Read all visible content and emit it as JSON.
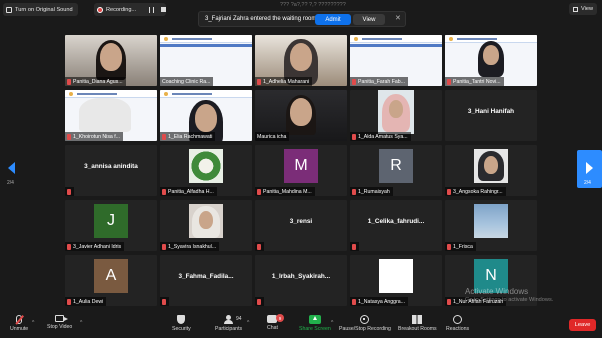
{
  "topbar": {
    "sound_label": "Turn on Original Sound",
    "recording_label": "Recording...",
    "meeting_title_ghost": "??? ?a?,?? ?,? ?????????",
    "view_label": "View"
  },
  "notification": {
    "message": "3_Fajriani Zahra entered the waiting room",
    "admit_label": "Admit",
    "view_label": "View",
    "close_glyph": "✕"
  },
  "pager": {
    "left": "2/4",
    "right": "2/4"
  },
  "tiles": [
    {
      "name": "Panitia_Diana Agus..."
    },
    {
      "name": "Coaching Clinic Ra..."
    },
    {
      "name": "1_Adhelia Maharani"
    },
    {
      "name": "Panitia_Farah Fab..."
    },
    {
      "name": "Panitia_Tantri Novi..."
    },
    {
      "name": "1_Khoirotun Nisa f..."
    },
    {
      "name": "1_Elia Rachmawati"
    },
    {
      "name": "Maurica icha"
    },
    {
      "name": "1_Alda Amatus Sya..."
    },
    {
      "center": "3_Hani Hanifah"
    },
    {
      "center": "3_annisa anindita"
    },
    {
      "name": "Panitia_Alfadha H..."
    },
    {
      "name": "Panitia_Mahdina M...",
      "avatar_letter": "M"
    },
    {
      "name": "1_Rumaisyah",
      "avatar_letter": "R"
    },
    {
      "name": "3_Angsoka Rahingr..."
    },
    {
      "name": "3_Javier Adhani Idris",
      "avatar_letter": "J"
    },
    {
      "name": "1_Syavira Isnakhul..."
    },
    {
      "center": "3_rensi"
    },
    {
      "center": "1_Celika_fahrudi..."
    },
    {
      "name": "1_Frisca"
    },
    {
      "name": "1_Aulia Dewi",
      "avatar_letter": "A"
    },
    {
      "center": "3_Fahma_Fadila..."
    },
    {
      "center": "1_Irbah_Syakirah..."
    },
    {
      "name": "1_Natasya Anggra..."
    },
    {
      "name": "1_Nur Afifah Fairuzah",
      "avatar_letter": "N"
    }
  ],
  "watermark": {
    "line1": "Activate Windows",
    "line2": "Go to Settings to activate Windows."
  },
  "toolbar": {
    "unmute": "Unmute",
    "stop_video": "Stop Video",
    "security": "Security",
    "participants": "Participants",
    "participants_count": "94",
    "chat": "Chat",
    "chat_badge": "9",
    "share_screen": "Share Screen",
    "pause_stop_recording": "Pause/Stop Recording",
    "breakout_rooms": "Breakout Rooms",
    "reactions": "Reactions",
    "leave": "Leave"
  },
  "colors": {
    "accent": "#2d8cff",
    "admit": "#0e71eb",
    "mute": "#e04b4b",
    "share": "#22b14c",
    "leave": "#e02828"
  }
}
